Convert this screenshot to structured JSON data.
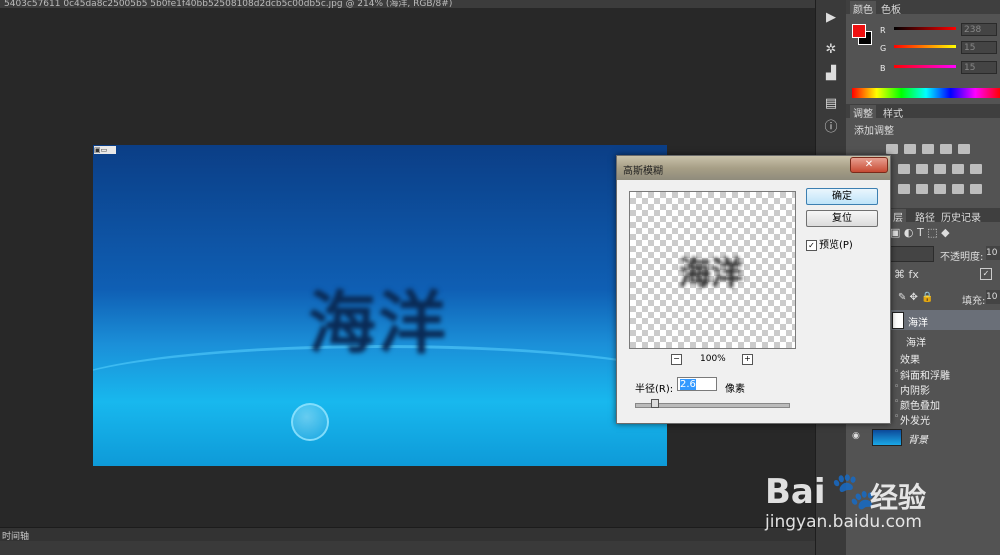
{
  "document": {
    "tab_title": "5403c57611 0c45da8c25005b5 5b0fe1f40bb52508108d2dcb5c00db5c.jpg @ 214% (海洋, RGB/8#)",
    "canvas_text": "海洋"
  },
  "timeline": {
    "label": "时间轴"
  },
  "color_panel": {
    "tabs": [
      "颜色",
      "色板"
    ],
    "foreground": "#ee0f0f",
    "background": "#000000",
    "channels": [
      {
        "label": "R",
        "value": "238"
      },
      {
        "label": "G",
        "value": "15"
      },
      {
        "label": "B",
        "value": "15"
      }
    ]
  },
  "adjust_panel": {
    "tabs": [
      "调整",
      "样式"
    ],
    "title": "添加调整"
  },
  "layers_panel": {
    "tabs": [
      "层",
      "路径",
      "历史记录"
    ],
    "opacity_label": "不透明度:",
    "opacity_value": "10",
    "fill_label": "填充:",
    "fill_value": "10",
    "layer_name": "海洋",
    "layer_sub_name": "海洋",
    "effects_label": "效果",
    "effects": [
      "斜面和浮雕",
      "内阴影",
      "颜色叠加",
      "外发光"
    ],
    "background_layer": "背景"
  },
  "dialog": {
    "title": "高斯模糊",
    "close": "✕",
    "ok": "确定",
    "reset": "复位",
    "preview_label": "预览(P)",
    "preview_checked": true,
    "preview_text": "海洋",
    "zoom": "100%",
    "zoom_out": "−",
    "zoom_in": "+",
    "radius_label": "半径(R):",
    "radius_value": "2.6",
    "radius_unit": "像素",
    "radius_slider_fraction": 0.1
  },
  "watermark": {
    "logo": "Bai",
    "logo_cn": "经验",
    "url": "jingyan.baidu.com"
  },
  "colors": {
    "accent": "#3399ff",
    "panel_bg": "#535353"
  }
}
